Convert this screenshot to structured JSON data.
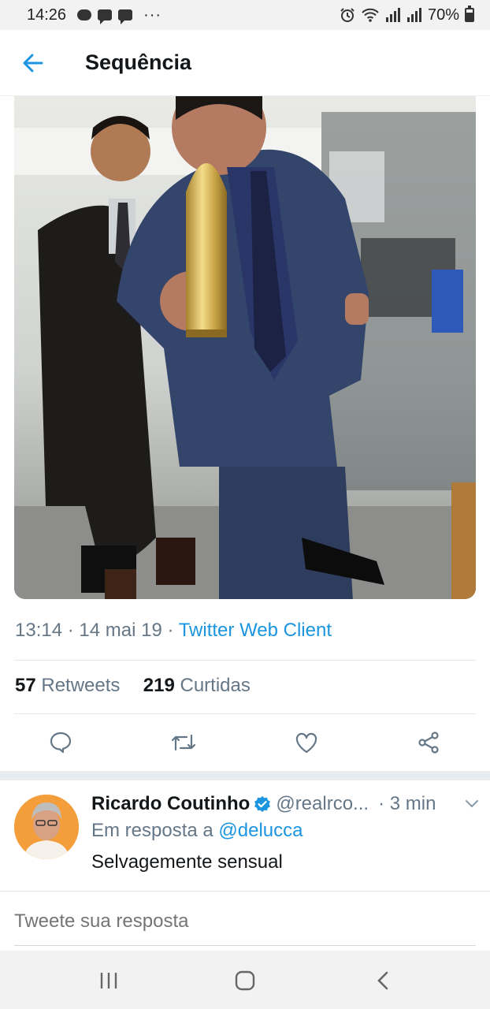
{
  "status_bar": {
    "time": "14:26",
    "battery": "70%",
    "more": "···"
  },
  "header": {
    "title": "Sequência"
  },
  "tweet": {
    "time": "13:14",
    "sep": "·",
    "date": "14 mai 19",
    "client": "Twitter Web Client",
    "retweets_count": "57",
    "retweets_label": "Retweets",
    "likes_count": "219",
    "likes_label": "Curtidas"
  },
  "reply": {
    "name": "Ricardo Coutinho",
    "handle": "@realrco...",
    "time": "· 3 min",
    "reply_to_label": "Em resposta a",
    "reply_to_handle": "@delucca",
    "text": "Selvagemente sensual"
  },
  "compose": {
    "placeholder": "Tweete sua resposta"
  },
  "colors": {
    "accent": "#1b95e0",
    "secondary_text": "#657786",
    "primary_text": "#14171a"
  }
}
